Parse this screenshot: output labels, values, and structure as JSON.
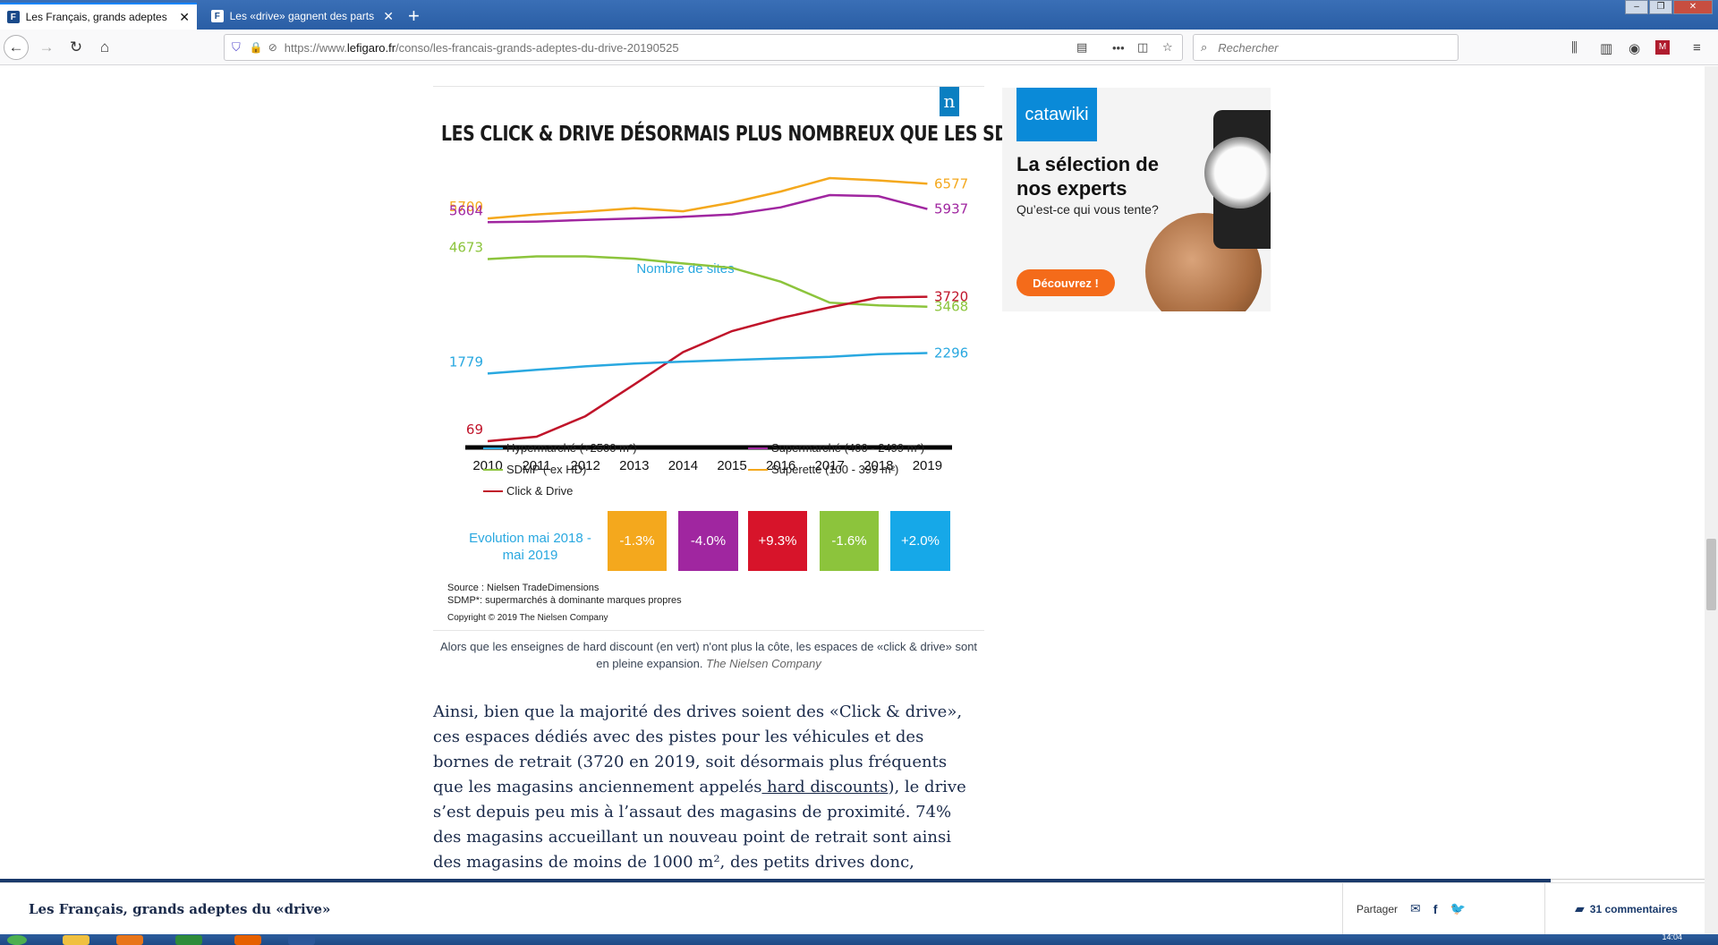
{
  "browser": {
    "tabs": [
      {
        "title": "Les Français, grands adeptes du «drive»",
        "favicon": "F"
      },
      {
        "title": "Les «drive» gagnent des parts de marché",
        "favicon": "F"
      }
    ],
    "new_tab": "+",
    "url_prefix": "https://www.",
    "url_domain": "lefigaro.fr",
    "url_path": "/conso/les-francais-grands-adeptes-du-drive-20190525",
    "search_placeholder": "Rechercher"
  },
  "figure": {
    "logo_letter": "n",
    "title": "LES CLICK & DRIVE DÉSORMAIS PLUS NOMBREUX QUE LES SDMP*",
    "legend": [
      {
        "label": "Hypermarché (+2500 m²)",
        "color": "#29a8e0"
      },
      {
        "label": "Supermarché (400 - 2499 m²)",
        "color": "#a026a0"
      },
      {
        "label": "SDMP ( ex HD)",
        "color": "#8cc43c"
      },
      {
        "label": "Superette (100 - 399 m²)",
        "color": "#f4a81d"
      },
      {
        "label": "Click & Drive",
        "color": "#c0142a"
      }
    ],
    "evolution_label": "Evolution mai 2018 - mai 2019",
    "evolution": [
      {
        "value": "-1.3%",
        "color": "#f4a81d"
      },
      {
        "value": "-4.0%",
        "color": "#a026a0"
      },
      {
        "value": "+9.3%",
        "color": "#d7142a"
      },
      {
        "value": "-1.6%",
        "color": "#8cc43c"
      },
      {
        "value": "+2.0%",
        "color": "#16a8e8"
      }
    ],
    "source_line1": "Source : Nielsen TradeDimensions",
    "source_line2": "SDMP*: supermarchés à dominante marques propres",
    "copyright": "Copyright © 2019 The Nielsen Company",
    "caption": "Alors que les enseignes de hard discount (en vert) n'ont plus la côte, les espaces de «click & drive» sont en pleine expansion.",
    "caption_credit": "The Nielsen Company"
  },
  "chart_data": {
    "type": "line",
    "title": "LES CLICK & DRIVE DÉSORMAIS PLUS NOMBREUX QUE LES SDMP*",
    "subtitle": "Nombre de sites",
    "x": [
      "2010",
      "2011",
      "2012",
      "2013",
      "2014",
      "2015",
      "2016",
      "2017",
      "2018",
      "2019"
    ],
    "series": [
      {
        "name": "Superette (100 - 399 m²)",
        "color": "#f4a81d",
        "values": [
          5700,
          5800,
          5870,
          5960,
          5880,
          6100,
          6380,
          6720,
          6660,
          6577
        ],
        "start_label": "5700",
        "end_label": "6577"
      },
      {
        "name": "Supermarché (400 - 2499 m²)",
        "color": "#a026a0",
        "values": [
          5604,
          5620,
          5660,
          5700,
          5740,
          5800,
          5980,
          6290,
          6260,
          5937
        ],
        "start_label": "5604",
        "end_label": "5937"
      },
      {
        "name": "SDMP ( ex HD)",
        "color": "#8cc43c",
        "values": [
          4673,
          4740,
          4740,
          4680,
          4560,
          4450,
          4100,
          3570,
          3500,
          3468
        ],
        "start_label": "4673",
        "end_label": "3468"
      },
      {
        "name": "Click & Drive",
        "color": "#c0142a",
        "values": [
          69,
          180,
          700,
          1500,
          2320,
          2850,
          3180,
          3450,
          3700,
          3720
        ],
        "start_label": "69",
        "end_label": "3720"
      },
      {
        "name": "Hypermarché (+2500 m²)",
        "color": "#29a8e0",
        "values": [
          1779,
          1870,
          1960,
          2030,
          2080,
          2120,
          2160,
          2200,
          2270,
          2296
        ],
        "start_label": "1779",
        "end_label": "2296"
      }
    ],
    "grid": false,
    "legend_position": "bottom"
  },
  "article": {
    "p1_before": "Ainsi, bien que la majorité des drives soient des «Click & drive», ces espaces dédiés avec des pistes pour les véhicules et des bornes de retrait (3720 en 2019, soit désormais plus fréquents que les magasins anciennement appelés",
    "p1_link": " hard discounts",
    "p1_after": "), le drive s’est depuis peu mis à l’assaut des magasins de proximité. 74% des magasins accueillant un nouveau point de retrait sont ainsi des magasins de moins de 1000 m², des petits drives donc, auxquels vient se rajouter le tout récent"
  },
  "ad": {
    "brand": "catawiki",
    "headline": "La sélection de nos experts",
    "sub": "Qu’est-ce qui vous tente?",
    "cta": "Découvrez !"
  },
  "footer": {
    "title": "Les Français, grands adeptes du «drive»",
    "share_label": "Partager",
    "comments": "31 commentaires"
  },
  "taskbar": {
    "clock": "14:04"
  }
}
